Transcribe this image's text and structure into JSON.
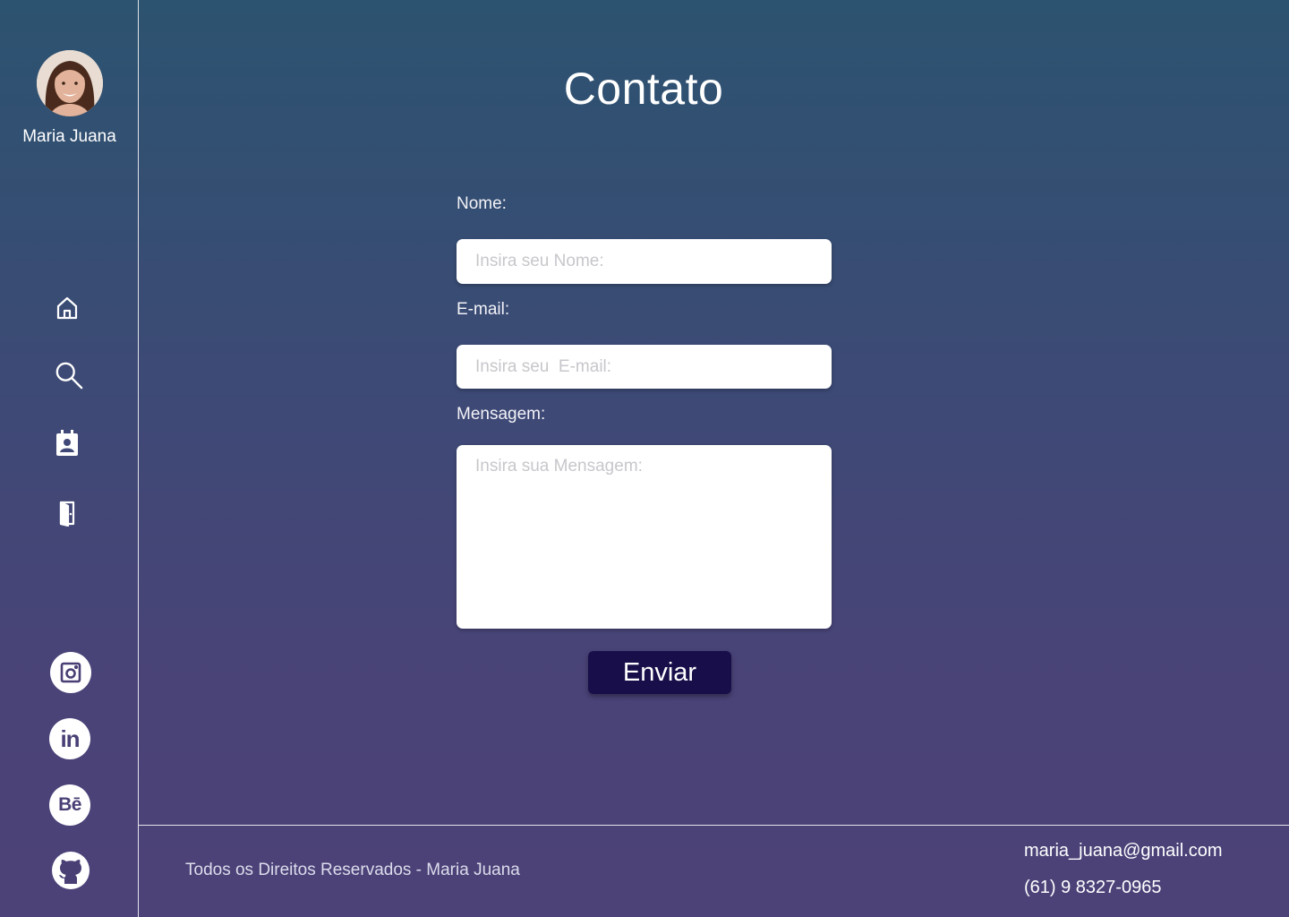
{
  "profile": {
    "name": "Maria Juana"
  },
  "nav": {
    "items": [
      {
        "icon": "home-icon"
      },
      {
        "icon": "search-icon"
      },
      {
        "icon": "contact-calendar-icon"
      },
      {
        "icon": "exit-door-icon"
      }
    ]
  },
  "social": [
    {
      "icon": "instagram-icon"
    },
    {
      "icon": "linkedin-icon",
      "text": "in"
    },
    {
      "icon": "behance-icon",
      "text": "Bē"
    },
    {
      "icon": "github-icon"
    }
  ],
  "page": {
    "title": "Contato"
  },
  "form": {
    "name_label": "Nome:",
    "name_placeholder": "Insira seu Nome:",
    "email_label": "E-mail:",
    "email_placeholder": "Insira seu  E-mail:",
    "message_label": "Mensagem:",
    "message_placeholder": "Insira sua Mensagem:",
    "submit_label": "Enviar"
  },
  "footer": {
    "copyright": "Todos os Direitos Reservados - Maria Juana",
    "email": "maria_juana@gmail.com",
    "phone": "(61) 9 8327-0965"
  },
  "colors": {
    "background_top": "#2c5370",
    "background_bottom": "#4c4278",
    "button": "#180f4a",
    "social_icon": "#4a3f75"
  }
}
